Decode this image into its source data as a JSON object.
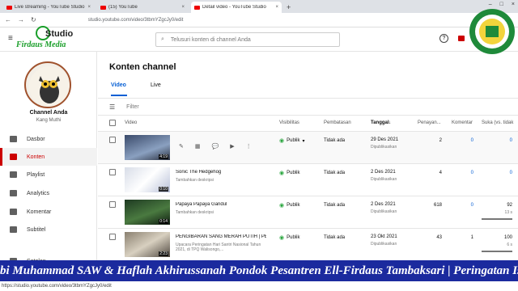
{
  "browser": {
    "tabs": [
      {
        "label": "Live streaming - YouTube Studio",
        "close": "×"
      },
      {
        "label": "(15) YouTube",
        "close": "×"
      },
      {
        "label": "Detail video - YouTube Studio",
        "close": "×"
      }
    ],
    "new_tab": "+",
    "window_controls": [
      "–",
      "□",
      "×"
    ],
    "nav": [
      "←",
      "→",
      "↻"
    ],
    "url": "studio.youtube.com/video/3tbmYZgcJy0/edit",
    "status_url": "https://studio.youtube.com/video/3tbmYZgcJy0/edit"
  },
  "header": {
    "menu_icon": "≡",
    "logo_text": "Studio",
    "logo_sub": "Firdaus Media",
    "search_icon": "⌕",
    "search_placeholder": "Telusuri konten di channel Anda",
    "help_icon": "?"
  },
  "sidebar": {
    "channel_name": "Channel Anda",
    "channel_owner": "Kang Muthi",
    "items": [
      {
        "label": "Dasbor"
      },
      {
        "label": "Konten"
      },
      {
        "label": "Playlist"
      },
      {
        "label": "Analytics"
      },
      {
        "label": "Komentar"
      },
      {
        "label": "Subtitel"
      },
      {
        "label": "Setelan"
      }
    ]
  },
  "content": {
    "title": "Konten channel",
    "tabs": [
      {
        "label": "Video"
      },
      {
        "label": "Live"
      }
    ],
    "filter_icon": "☰",
    "filter_placeholder": "Filter",
    "columns": {
      "video": "Video",
      "visibility": "Visibilitas",
      "restriction": "Pembatasan",
      "date": "Tanggal",
      "date_sort": "↓",
      "views": "Penayan...",
      "comments": "Komentar",
      "likes": "Suka (vs. tidak"
    },
    "row_actions": [
      "✎",
      "▦",
      "💬",
      "▶",
      "⋮"
    ],
    "rows": [
      {
        "title": "",
        "desc": "",
        "duration": "4:19",
        "visibility": "Publik",
        "dropdown": "▾",
        "restriction": "Tidak ada",
        "date": "29 Des 2021",
        "date_sub": "Dipublikasikan",
        "views": "2",
        "comments": "0",
        "likes": "0",
        "likes_sub": ""
      },
      {
        "title": "Sonic The Hedgehog",
        "desc": "Tambahkan deskripsi",
        "duration": "0:10",
        "visibility": "Publik",
        "dropdown": "",
        "restriction": "Tidak ada",
        "date": "2 Des 2021",
        "date_sub": "Dipublikasikan",
        "views": "4",
        "comments": "0",
        "likes": "0",
        "likes_sub": ""
      },
      {
        "title": "Papaya Papaya Gandul",
        "desc": "Tambahkan deskripsi",
        "duration": "0:14",
        "visibility": "Publik",
        "dropdown": "",
        "restriction": "Tidak ada",
        "date": "2 Des 2021",
        "date_sub": "Dipublikasikan",
        "views": "618",
        "comments": "0",
        "likes": "92",
        "likes_sub": "13 s"
      },
      {
        "title": "PENGIBARAN SANG MERAH PUTIH | PE...",
        "desc": "Upacara Peringatan Hari Santri Nasional Tahun 2021, di TPQ Walisongo,...",
        "duration": "2:23",
        "visibility": "Publik",
        "dropdown": "",
        "restriction": "Tidak ada",
        "date": "23 Okt 2021",
        "date_sub": "Dipublikasikan",
        "views": "43",
        "comments": "1",
        "likes": "100",
        "likes_sub": "6 s"
      }
    ]
  },
  "ticker": "bi Muhammad SAW & Haflah Akhirussanah Pondok Pesantren Ell-Firdaus Tambaksari  |  Peringatan Isro' Mi'roj N"
}
